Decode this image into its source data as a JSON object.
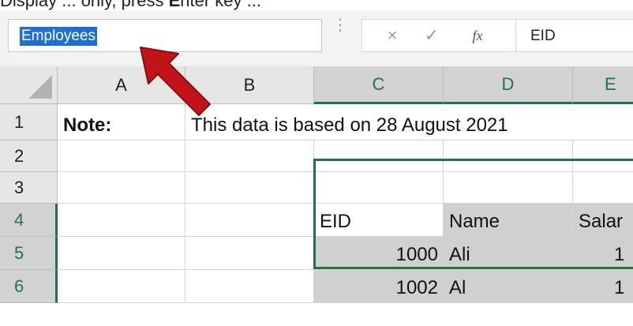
{
  "caption": {
    "text_before": "...play ",
    "text_bold": "E",
    "text_after": "..."
  },
  "name_box": {
    "value": "Employees"
  },
  "formula_bar": {
    "cancel_glyph": "×",
    "enter_glyph": "✓",
    "fx_label": "fx",
    "value": "EID"
  },
  "columns": [
    {
      "label": "A",
      "selected": false
    },
    {
      "label": "B",
      "selected": false
    },
    {
      "label": "C",
      "selected": true
    },
    {
      "label": "D",
      "selected": true
    },
    {
      "label": "E",
      "selected": true
    }
  ],
  "rows": [
    {
      "label": "1",
      "selected": false
    },
    {
      "label": "2",
      "selected": false
    },
    {
      "label": "3",
      "selected": false
    },
    {
      "label": "4",
      "selected": true
    },
    {
      "label": "5",
      "selected": true
    },
    {
      "label": "6",
      "selected": true
    }
  ],
  "cells": {
    "A1": "Note:",
    "B1": "This data is based on 28 August 2021",
    "C4": "EID",
    "D4": "Name",
    "E4": "Salar",
    "C5": "1000",
    "D5": "Ali",
    "E5": "1",
    "C6": "1002",
    "D6": "Al",
    "E6": "1"
  },
  "colors": {
    "selection_green": "#217346",
    "arrow_red": "#c0141a",
    "name_highlight": "#1f6fd1"
  }
}
